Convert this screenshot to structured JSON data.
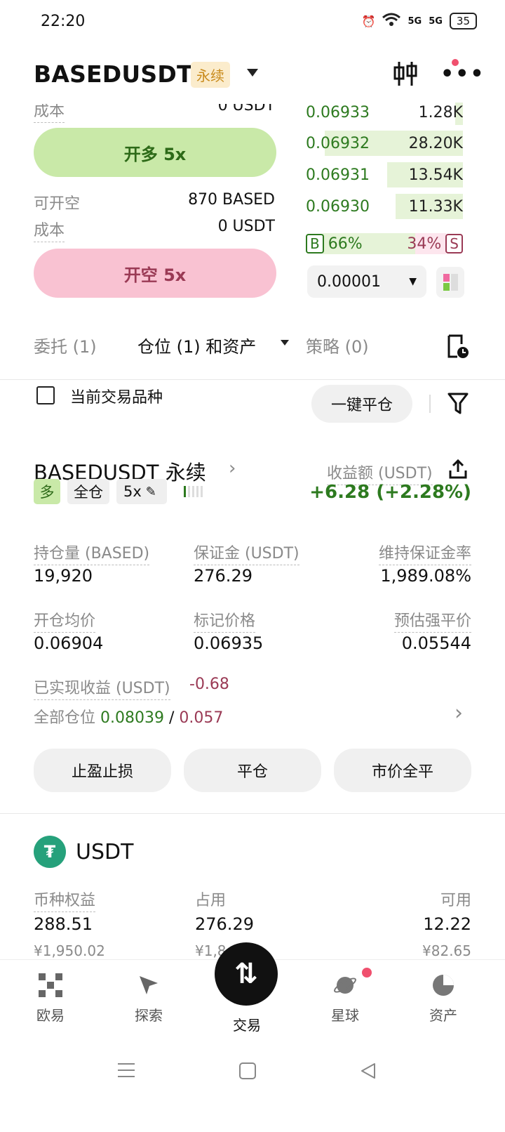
{
  "status_bar": {
    "time": "22:20",
    "signal1": "5G",
    "signal2": "5G",
    "battery": "35"
  },
  "header": {
    "pair": "BASEDUSDT",
    "badge": "永续"
  },
  "trade_panel": {
    "cost_label_top": "成本",
    "cost_value_top": "0 USDT",
    "long_button": "开多 5x",
    "short_avail_label": "可开空",
    "short_avail_value": "870 BASED",
    "cost_label": "成本",
    "cost_value": "0 USDT",
    "short_button": "开空 5x"
  },
  "order_book": {
    "rows": [
      {
        "price": "0.06933",
        "qty": "1.28K",
        "depth": 0.05
      },
      {
        "price": "0.06932",
        "qty": "28.20K",
        "depth": 0.88
      },
      {
        "price": "0.06931",
        "qty": "13.54K",
        "depth": 0.48
      },
      {
        "price": "0.06930",
        "qty": "11.33K",
        "depth": 0.43
      }
    ],
    "buy_label": "B",
    "buy_pct": "66%",
    "sell_pct": "34%",
    "sell_label": "S",
    "buy_ratio": 0.66,
    "tick_size": "0.00001"
  },
  "tabs": {
    "orders": "委托 (1)",
    "positions": "仓位 (1) 和资产",
    "strategy": "策略 (0)"
  },
  "filter": {
    "current_symbol": "当前交易品种",
    "close_all": "一键平仓"
  },
  "position": {
    "title": "BASEDUSDT 永续",
    "pnl_label": "收益额 (USDT)",
    "pnl_value": "+6.28 (+2.28%)",
    "tags": {
      "side": "多",
      "margin_mode": "全仓",
      "leverage": "5x"
    },
    "fields": [
      {
        "label": "持仓量 (BASED)",
        "value": "19,920"
      },
      {
        "label": "保证金 (USDT)",
        "value": "276.29"
      },
      {
        "label": "维持保证金率",
        "value": "1,989.08%"
      },
      {
        "label": "开仓均价",
        "value": "0.06904"
      },
      {
        "label": "标记价格",
        "value": "0.06935"
      },
      {
        "label": "预估强平价",
        "value": "0.05544"
      }
    ],
    "realized_label": "已实现收益 (USDT)",
    "realized_value": "-0.68",
    "all_positions_label": "全部仓位",
    "all_positions_long": "0.08039",
    "all_positions_sep": "/",
    "all_positions_short": "0.057",
    "actions": [
      "止盈止损",
      "平仓",
      "市价全平"
    ]
  },
  "asset": {
    "name": "USDT",
    "equity_label": "币种权益",
    "equity_value": "288.51",
    "equity_cny": "¥1,950.02",
    "used_label": "占用",
    "used_value": "276.29",
    "used_cny": "¥1,8",
    "avail_label": "可用",
    "avail_value": "12.22",
    "avail_cny": "¥82.65"
  },
  "bottom_nav": {
    "items": [
      "欧易",
      "探索",
      "交易",
      "星球",
      "资产"
    ]
  },
  "colors": {
    "long_green": "#c9e9a8",
    "short_pink": "#f9c2d2",
    "text_green": "#2d7a1f",
    "text_red": "#9a3a55",
    "badge_bg": "#fbeccc"
  }
}
